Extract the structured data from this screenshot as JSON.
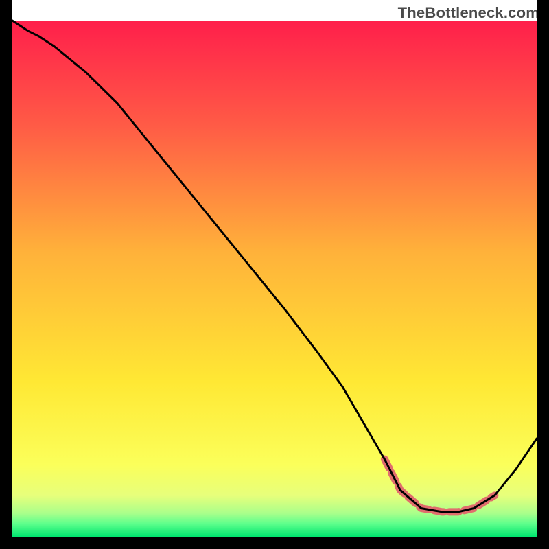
{
  "watermark": "TheBottleneck.com",
  "chart_data": {
    "type": "line",
    "title": "",
    "xlabel": "",
    "ylabel": "",
    "xlim": [
      0,
      100
    ],
    "ylim": [
      0,
      100
    ],
    "grid": false,
    "legend": false,
    "gradient_stops": [
      {
        "offset": 0.0,
        "color": "#ff1f4b"
      },
      {
        "offset": 0.2,
        "color": "#ff5a46"
      },
      {
        "offset": 0.45,
        "color": "#ffb23a"
      },
      {
        "offset": 0.7,
        "color": "#ffe834"
      },
      {
        "offset": 0.86,
        "color": "#fbff5a"
      },
      {
        "offset": 0.92,
        "color": "#e7ff7b"
      },
      {
        "offset": 0.955,
        "color": "#a9ff8b"
      },
      {
        "offset": 0.975,
        "color": "#5eff8c"
      },
      {
        "offset": 1.0,
        "color": "#00e56f"
      }
    ],
    "series": [
      {
        "name": "curve",
        "color": "#000000",
        "stroke_width": 3,
        "x": [
          0,
          3,
          5,
          8,
          14,
          20,
          28,
          36,
          44,
          52,
          58,
          63,
          67,
          71,
          74,
          78,
          82,
          85,
          88,
          92,
          96,
          100
        ],
        "values": [
          100,
          98,
          97,
          95,
          90,
          84,
          74,
          64,
          54,
          44,
          36,
          29,
          22,
          15,
          9,
          5.5,
          4.8,
          4.8,
          5.5,
          8,
          13,
          19
        ]
      },
      {
        "name": "highlight-region",
        "color": "#e06d6d",
        "stroke_width": 11,
        "x": [
          71,
          74,
          78,
          82,
          85,
          88,
          92
        ],
        "values": [
          15,
          9,
          5.5,
          4.8,
          4.8,
          5.5,
          8
        ]
      }
    ],
    "notes": "Values are approximate, read off the figure. Y is percent-of-frame-height above the inner bottom edge; X is percent across inner width."
  }
}
